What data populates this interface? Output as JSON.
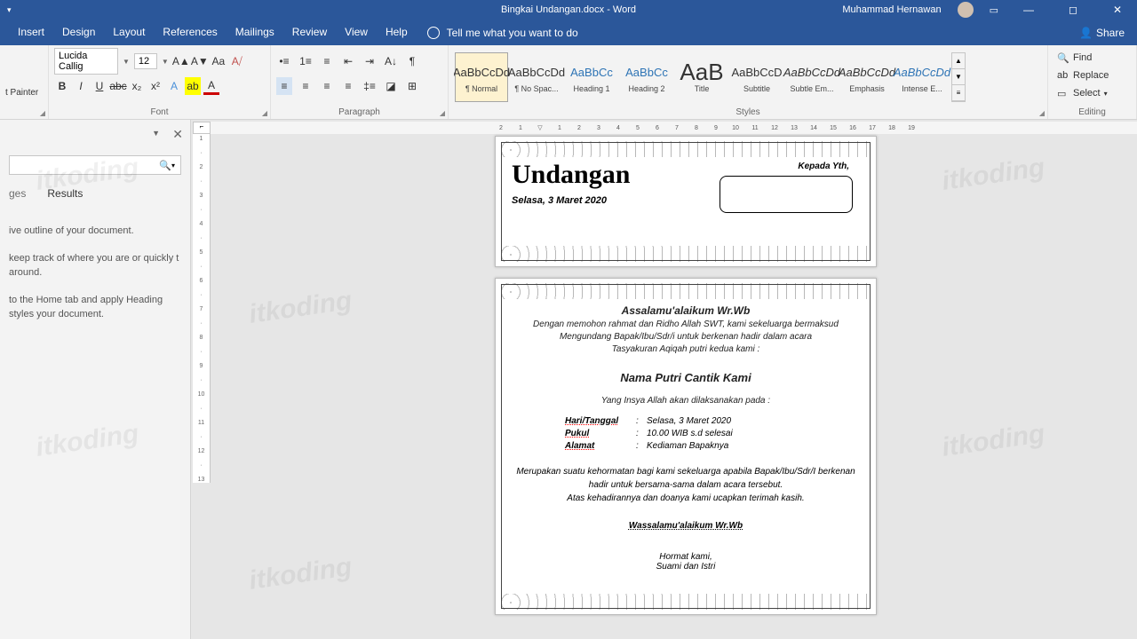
{
  "titlebar": {
    "doc": "Bingkai Undangan.docx  -  Word",
    "user": "Muhammad Hernawan"
  },
  "menu": {
    "tabs": [
      "Insert",
      "Design",
      "Layout",
      "References",
      "Mailings",
      "Review",
      "View",
      "Help"
    ],
    "tell": "Tell me what you want to do",
    "share": "Share"
  },
  "ribbon": {
    "clipboard": {
      "painter": "t Painter"
    },
    "font": {
      "name": "Lucida Callig",
      "size": "12",
      "group": "Font"
    },
    "paragraph": {
      "group": "Paragraph"
    },
    "styles": {
      "group": "Styles",
      "items": [
        {
          "samp": "AaBbCcDd",
          "lbl": "¶ Normal",
          "sel": true
        },
        {
          "samp": "AaBbCcDd",
          "lbl": "¶ No Spac..."
        },
        {
          "samp": "AaBbCc",
          "lbl": "Heading 1",
          "blue": true
        },
        {
          "samp": "AaBbCc",
          "lbl": "Heading 2",
          "blue": true
        },
        {
          "samp": "AaB",
          "lbl": "Title",
          "big": true
        },
        {
          "samp": "AaBbCcD",
          "lbl": "Subtitle"
        },
        {
          "samp": "AaBbCcDd",
          "lbl": "Subtle Em...",
          "ital": true
        },
        {
          "samp": "AaBbCcDd",
          "lbl": "Emphasis",
          "ital": true
        },
        {
          "samp": "AaBbCcDd",
          "lbl": "Intense E...",
          "ital": true,
          "blue": true
        }
      ]
    },
    "editing": {
      "group": "Editing",
      "find": "Find",
      "replace": "Replace",
      "select": "Select"
    }
  },
  "nav": {
    "tabs": [
      "ges",
      "Results"
    ],
    "lines": [
      "ive outline of your document.",
      "keep track of where you are or quickly t around.",
      "to the Home tab and apply Heading styles your document."
    ]
  },
  "doc": {
    "title": "Undangan",
    "date": "Selasa, 3 Maret 2020",
    "kepada": "Kepada Yth,",
    "salam": "Assalamu'alaikum Wr.Wb",
    "intro1": "Dengan memohon rahmat dan Ridho Allah SWT, kami sekeluarga bermaksud",
    "intro2": "Mengundang Bapak/Ibu/Sdr/i untuk berkenan hadir dalam acara",
    "intro3": "Tasyakuran Aqiqah putri kedua kami :",
    "nama": "Nama Putri Cantik Kami",
    "yang": "Yang Insya Allah akan dilaksanakan  pada :",
    "rows": [
      {
        "k": "Hari/Tanggal",
        "v": "Selasa, 3 Maret 2020"
      },
      {
        "k": "Pukul",
        "v": "10.00 WIB s.d selesai"
      },
      {
        "k": "Alamat",
        "v": "Kediaman Bapaknya"
      }
    ],
    "close1": "Merupakan suatu kehormatan bagi kami sekeluarga apabila Bapak/Ibu/Sdr/I berkenan hadir untuk bersama-sama dalam acara tersebut.",
    "close2": "Atas kehadirannya dan doanya kami ucapkan terimah kasih.",
    "wassalam": "Wassalamu'alaikum Wr.Wb",
    "hormat": "Hormat kami,",
    "ttd": "Suami dan Istri"
  },
  "watermark": "itkoding"
}
